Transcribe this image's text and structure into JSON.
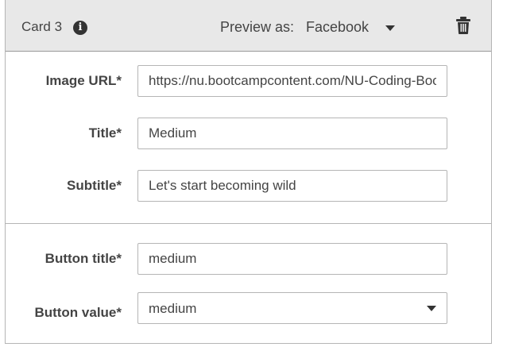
{
  "card": {
    "title": "Card 3",
    "info_icon": "info-circle-icon",
    "preview_label": "Preview as:",
    "preview_value": "Facebook",
    "delete_icon": "trash-icon"
  },
  "fields": {
    "image_url": {
      "label": "Image URL*",
      "value": "https://nu.bootcampcontent.com/NU-Coding-Bootcamp"
    },
    "title": {
      "label": "Title*",
      "value": "Medium"
    },
    "subtitle": {
      "label": "Subtitle*",
      "value": "Let's start becoming wild"
    },
    "button_title": {
      "label": "Button title*",
      "value": "medium"
    },
    "button_value": {
      "label": "Button value*",
      "value": "medium"
    }
  },
  "colors": {
    "header_bg": "#e8e8e8",
    "border": "#b5b5b5",
    "text": "#444444"
  }
}
